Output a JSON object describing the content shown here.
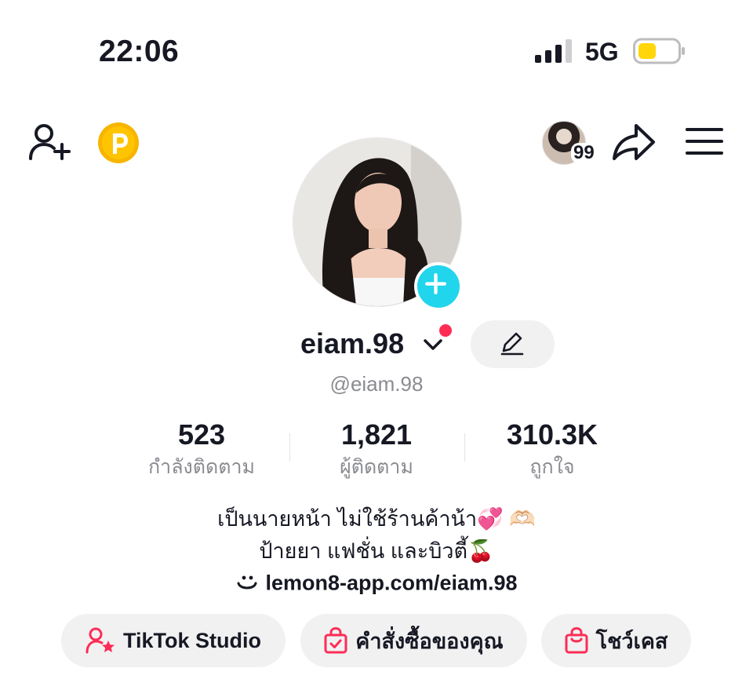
{
  "status_bar": {
    "time": "22:06",
    "network": "5G"
  },
  "header": {
    "friends_count": "99",
    "icons": [
      "add-user-icon",
      "coin-icon",
      "share-icon",
      "menu-icon"
    ]
  },
  "profile": {
    "username": "eiam.98",
    "handle": "@eiam.98"
  },
  "stats": [
    {
      "value": "523",
      "label": "กำลังติดตาม"
    },
    {
      "value": "1,821",
      "label": "ผู้ติดตาม"
    },
    {
      "value": "310.3K",
      "label": "ถูกใจ"
    }
  ],
  "bio": {
    "line1": "เป็นนายหน้า ไม่ใช้ร้านค้าน้า💞 🫶🏻",
    "line2": "ป้ายยา แฟชั่น และบิวตี้🍒",
    "link": "lemon8-app.com/eiam.98"
  },
  "actions": {
    "studio": "TikTok Studio",
    "orders": "คำสั่งซื้อของคุณ",
    "showcase": "โชว์เคส"
  },
  "colors": {
    "accent_red": "#fe2c55",
    "plus_cyan": "#20d5ec",
    "coin_yellow": "#f7b500",
    "battery_yellow": "#ffd60a"
  }
}
